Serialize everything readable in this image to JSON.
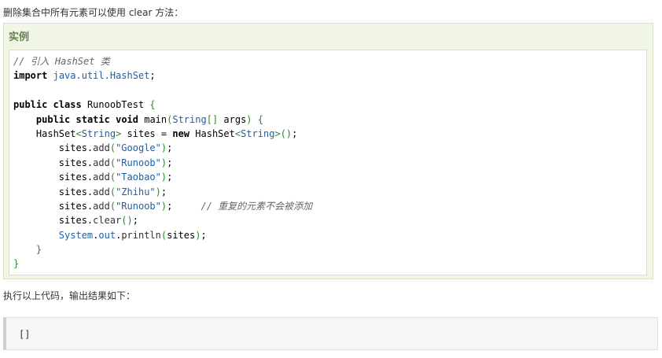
{
  "intro_text": "删除集合中所有元素可以使用 clear 方法：",
  "example_title": "实例",
  "code_lines": [
    [
      {
        "t": "cm",
        "v": "// 引入 HashSet 类"
      }
    ],
    [
      {
        "t": "kw",
        "v": "import"
      },
      {
        "t": "tk",
        "v": " "
      },
      {
        "t": "ty",
        "v": "java.util.HashSet"
      },
      {
        "t": "dt",
        "v": ";"
      }
    ],
    [],
    [
      {
        "t": "kw",
        "v": "public"
      },
      {
        "t": "tk",
        "v": " "
      },
      {
        "t": "kw",
        "v": "class"
      },
      {
        "t": "tk",
        "v": " RunoobTest "
      },
      {
        "t": "br",
        "v": "{"
      }
    ],
    [
      {
        "t": "tk",
        "v": "    "
      },
      {
        "t": "kw",
        "v": "public"
      },
      {
        "t": "tk",
        "v": " "
      },
      {
        "t": "kw",
        "v": "static"
      },
      {
        "t": "tk",
        "v": " "
      },
      {
        "t": "kw",
        "v": "void"
      },
      {
        "t": "tk",
        "v": " main"
      },
      {
        "t": "br",
        "v": "("
      },
      {
        "t": "ty",
        "v": "String"
      },
      {
        "t": "br",
        "v": "[]"
      },
      {
        "t": "tk",
        "v": " args"
      },
      {
        "t": "br",
        "v": ")"
      },
      {
        "t": "tk",
        "v": " "
      },
      {
        "t": "br",
        "v": "{"
      }
    ],
    [
      {
        "t": "tk",
        "v": "    HashSet"
      },
      {
        "t": "br",
        "v": "<"
      },
      {
        "t": "ty",
        "v": "String"
      },
      {
        "t": "br",
        "v": ">"
      },
      {
        "t": "tk",
        "v": " sites "
      },
      {
        "t": "dt",
        "v": "="
      },
      {
        "t": "tk",
        "v": " "
      },
      {
        "t": "kw",
        "v": "new"
      },
      {
        "t": "tk",
        "v": " HashSet"
      },
      {
        "t": "br",
        "v": "<"
      },
      {
        "t": "ty",
        "v": "String"
      },
      {
        "t": "br",
        "v": ">()"
      },
      {
        "t": "dt",
        "v": ";"
      }
    ],
    [
      {
        "t": "tk",
        "v": "        sites"
      },
      {
        "t": "dt",
        "v": "."
      },
      {
        "t": "mt",
        "v": "add"
      },
      {
        "t": "br",
        "v": "("
      },
      {
        "t": "st",
        "v": "\"Google\""
      },
      {
        "t": "br",
        "v": ")"
      },
      {
        "t": "dt",
        "v": ";"
      }
    ],
    [
      {
        "t": "tk",
        "v": "        sites"
      },
      {
        "t": "dt",
        "v": "."
      },
      {
        "t": "mt",
        "v": "add"
      },
      {
        "t": "br",
        "v": "("
      },
      {
        "t": "st",
        "v": "\"Runoob\""
      },
      {
        "t": "br",
        "v": ")"
      },
      {
        "t": "dt",
        "v": ";"
      }
    ],
    [
      {
        "t": "tk",
        "v": "        sites"
      },
      {
        "t": "dt",
        "v": "."
      },
      {
        "t": "mt",
        "v": "add"
      },
      {
        "t": "br",
        "v": "("
      },
      {
        "t": "st",
        "v": "\"Taobao\""
      },
      {
        "t": "br",
        "v": ")"
      },
      {
        "t": "dt",
        "v": ";"
      }
    ],
    [
      {
        "t": "tk",
        "v": "        sites"
      },
      {
        "t": "dt",
        "v": "."
      },
      {
        "t": "mt",
        "v": "add"
      },
      {
        "t": "br",
        "v": "("
      },
      {
        "t": "st",
        "v": "\"Zhihu\""
      },
      {
        "t": "br",
        "v": ")"
      },
      {
        "t": "dt",
        "v": ";"
      }
    ],
    [
      {
        "t": "tk",
        "v": "        sites"
      },
      {
        "t": "dt",
        "v": "."
      },
      {
        "t": "mt",
        "v": "add"
      },
      {
        "t": "br",
        "v": "("
      },
      {
        "t": "st",
        "v": "\"Runoob\""
      },
      {
        "t": "br",
        "v": ")"
      },
      {
        "t": "dt",
        "v": ";"
      },
      {
        "t": "tk",
        "v": "     "
      },
      {
        "t": "cm",
        "v": "// 重复的元素不会被添加"
      }
    ],
    [
      {
        "t": "tk",
        "v": "        sites"
      },
      {
        "t": "dt",
        "v": "."
      },
      {
        "t": "mt",
        "v": "clear"
      },
      {
        "t": "br",
        "v": "()"
      },
      {
        "t": "dt",
        "v": ";"
      }
    ],
    [
      {
        "t": "tk",
        "v": "        "
      },
      {
        "t": "ty",
        "v": "System"
      },
      {
        "t": "dt",
        "v": "."
      },
      {
        "t": "ty",
        "v": "out"
      },
      {
        "t": "dt",
        "v": "."
      },
      {
        "t": "mt",
        "v": "println"
      },
      {
        "t": "br",
        "v": "("
      },
      {
        "t": "tk",
        "v": "sites"
      },
      {
        "t": "br",
        "v": ")"
      },
      {
        "t": "dt",
        "v": ";"
      }
    ],
    [
      {
        "t": "tk",
        "v": "    "
      },
      {
        "t": "br",
        "v": "}"
      }
    ],
    [
      {
        "t": "br",
        "v": "}"
      }
    ]
  ],
  "result_text": "执行以上代码，输出结果如下：",
  "output_text": "[]"
}
